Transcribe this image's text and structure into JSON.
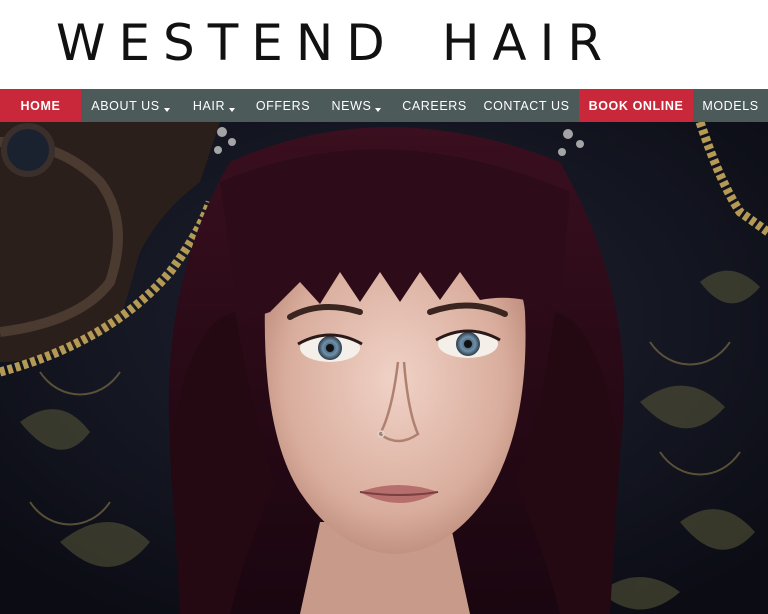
{
  "brand": {
    "word1": "WESTEND",
    "word2": "HAIR"
  },
  "nav": {
    "items": [
      {
        "label": "HOME",
        "dropdown": false,
        "accent": true
      },
      {
        "label": "ABOUT US",
        "dropdown": true,
        "accent": false
      },
      {
        "label": "HAIR",
        "dropdown": true,
        "accent": false
      },
      {
        "label": "OFFERS",
        "dropdown": false,
        "accent": false
      },
      {
        "label": "NEWS",
        "dropdown": true,
        "accent": false
      },
      {
        "label": "CAREERS",
        "dropdown": false,
        "accent": false
      },
      {
        "label": "CONTACT US",
        "dropdown": false,
        "accent": false
      },
      {
        "label": "BOOK ONLINE",
        "dropdown": false,
        "accent": true
      },
      {
        "label": "MODELS",
        "dropdown": false,
        "accent": false
      }
    ]
  },
  "colors": {
    "nav_bg": "#4c5a59",
    "accent": "#c8283a",
    "logo": "#111111"
  },
  "hero": {
    "image": "hero-portrait-image"
  }
}
